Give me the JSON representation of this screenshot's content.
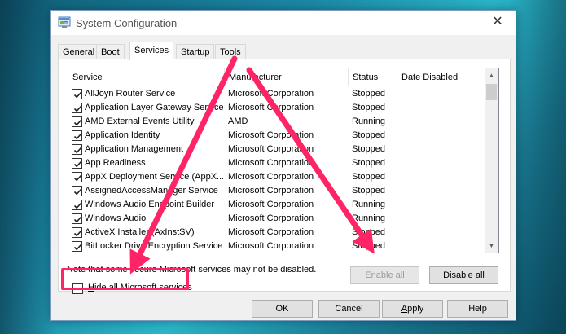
{
  "window": {
    "title": "System Configuration",
    "close_glyph": "✕"
  },
  "tabs": [
    {
      "label": "General"
    },
    {
      "label": "Boot"
    },
    {
      "label": "Services",
      "active": true
    },
    {
      "label": "Startup"
    },
    {
      "label": "Tools"
    }
  ],
  "services": {
    "columns": [
      "Service",
      "Manufacturer",
      "Status",
      "Date Disabled"
    ],
    "rows": [
      {
        "name": "AllJoyn Router Service",
        "manufacturer": "Microsoft Corporation",
        "status": "Stopped",
        "date_disabled": "",
        "checked": true
      },
      {
        "name": "Application Layer Gateway Service",
        "manufacturer": "Microsoft Corporation",
        "status": "Stopped",
        "date_disabled": "",
        "checked": true
      },
      {
        "name": "AMD External Events Utility",
        "manufacturer": "AMD",
        "status": "Running",
        "date_disabled": "",
        "checked": true
      },
      {
        "name": "Application Identity",
        "manufacturer": "Microsoft Corporation",
        "status": "Stopped",
        "date_disabled": "",
        "checked": true
      },
      {
        "name": "Application Management",
        "manufacturer": "Microsoft Corporation",
        "status": "Stopped",
        "date_disabled": "",
        "checked": true
      },
      {
        "name": "App Readiness",
        "manufacturer": "Microsoft Corporation",
        "status": "Stopped",
        "date_disabled": "",
        "checked": true
      },
      {
        "name": "AppX Deployment Service (AppX...",
        "manufacturer": "Microsoft Corporation",
        "status": "Stopped",
        "date_disabled": "",
        "checked": true
      },
      {
        "name": "AssignedAccessManager Service",
        "manufacturer": "Microsoft Corporation",
        "status": "Stopped",
        "date_disabled": "",
        "checked": true
      },
      {
        "name": "Windows Audio Endpoint Builder",
        "manufacturer": "Microsoft Corporation",
        "status": "Running",
        "date_disabled": "",
        "checked": true
      },
      {
        "name": "Windows Audio",
        "manufacturer": "Microsoft Corporation",
        "status": "Running",
        "date_disabled": "",
        "checked": true
      },
      {
        "name": "ActiveX Installer (AxInstSV)",
        "manufacturer": "Microsoft Corporation",
        "status": "Stopped",
        "date_disabled": "",
        "checked": true
      },
      {
        "name": "BitLocker Drive Encryption Service",
        "manufacturer": "Microsoft Corporation",
        "status": "Stopped",
        "date_disabled": "",
        "checked": true
      }
    ]
  },
  "note": "Note that some secure Microsoft services may not be disabled.",
  "buttons": {
    "enable_all": {
      "label": "Enable all",
      "enabled": false
    },
    "disable_all": {
      "pre": "",
      "ul": "D",
      "post": "isable all",
      "enabled": true
    },
    "ok": "OK",
    "cancel": "Cancel",
    "apply": {
      "pre": "",
      "ul": "A",
      "post": "pply"
    },
    "help": "Help"
  },
  "hide_ms": {
    "pre": "",
    "ul": "H",
    "post": "ide all Microsoft services",
    "checked": false
  },
  "colors": {
    "annotation": "#ff2466",
    "window_bg": "#f0f0f0",
    "desktop": "#1c8aa8"
  },
  "icons": [
    "msconfig-icon",
    "close-icon",
    "checkbox-checked-icon",
    "scroll-up-icon",
    "scroll-down-icon",
    "annotation-arrow-icon"
  ]
}
